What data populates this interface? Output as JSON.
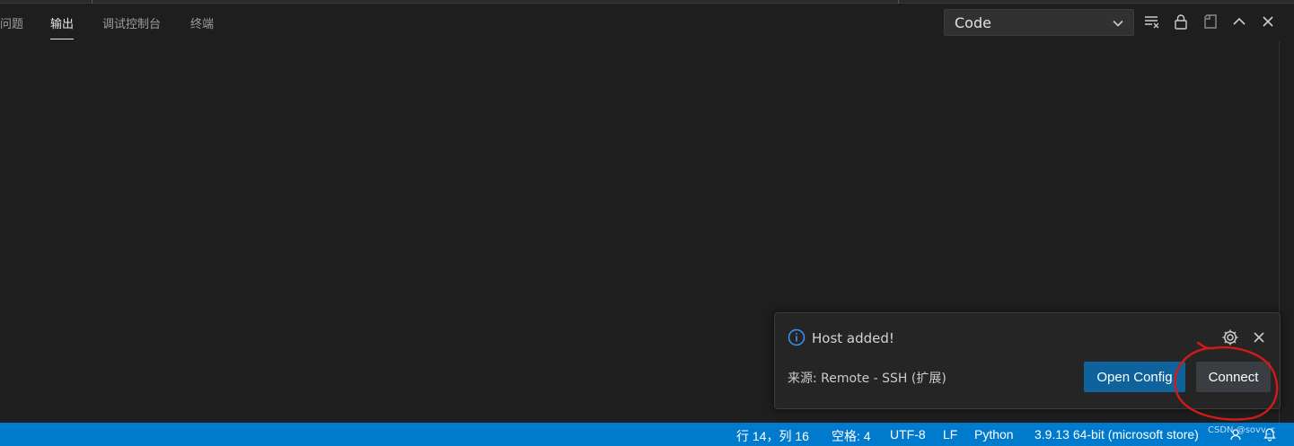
{
  "panel": {
    "tabs": [
      {
        "label": "问题",
        "active": false
      },
      {
        "label": "输出",
        "active": true
      },
      {
        "label": "调试控制台",
        "active": false
      },
      {
        "label": "终端",
        "active": false
      }
    ],
    "output_channel": {
      "selected": "Code"
    },
    "icons": [
      "clear-output-icon",
      "lock-icon",
      "open-in-editor-icon",
      "chevron-up-icon",
      "close-icon"
    ]
  },
  "notification": {
    "message": "Host added!",
    "source": "来源: Remote - SSH (扩展)",
    "buttons": {
      "open_config": "Open Config",
      "connect": "Connect"
    },
    "icons": [
      "info-icon",
      "gear-icon",
      "close-icon"
    ]
  },
  "statusbar": {
    "position": "行 14，列 16",
    "spaces": "空格: 4",
    "encoding": "UTF-8",
    "eol": "LF",
    "language": "Python",
    "interpreter": "3.9.13 64-bit (microsoft store)",
    "icons": [
      "feedback-icon",
      "bell-icon"
    ]
  },
  "watermark": "CSDN @sovv_c",
  "colors": {
    "statusbar": "#007acc",
    "primary_button": "#0e639c",
    "annotation": "#d11a1a",
    "info": "#3794ff"
  }
}
